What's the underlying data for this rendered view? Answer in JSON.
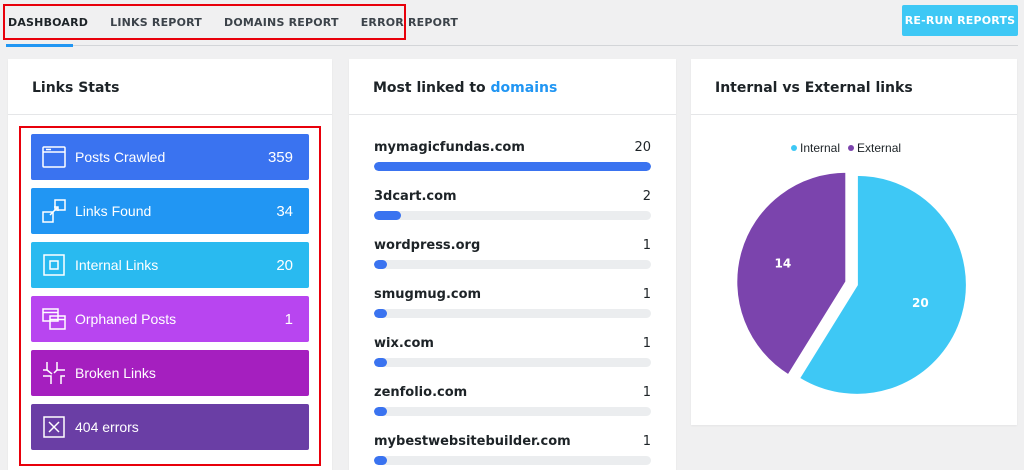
{
  "nav": {
    "tabs": [
      "DASHBOARD",
      "LINKS REPORT",
      "DOMAINS REPORT",
      "ERROR REPORT"
    ],
    "rerun_label": "RE-RUN REPORTS"
  },
  "links_stats": {
    "title": "Links Stats",
    "items": [
      {
        "label": "Posts Crawled",
        "value": "359",
        "color": "#3a73f0",
        "icon": "browser-window-icon"
      },
      {
        "label": "Links Found",
        "value": "34",
        "color": "#2196f3",
        "icon": "link-arrows-icon"
      },
      {
        "label": "Internal Links",
        "value": "20",
        "color": "#29baf0",
        "icon": "internal-square-icon"
      },
      {
        "label": "Orphaned Posts",
        "value": "1",
        "color": "#b845f0",
        "icon": "stacked-windows-icon"
      },
      {
        "label": "Broken Links",
        "value": "",
        "color": "#a51fbf",
        "icon": "broken-link-icon"
      },
      {
        "label": "404 errors",
        "value": "",
        "color": "#6a3ea5",
        "icon": "x-box-icon"
      }
    ]
  },
  "domains": {
    "title_prefix": "Most linked to",
    "title_accent": "domains",
    "max": 20,
    "items": [
      {
        "name": "mymagicfundas.com",
        "count": 20
      },
      {
        "name": "3dcart.com",
        "count": 2
      },
      {
        "name": "wordpress.org",
        "count": 1
      },
      {
        "name": "smugmug.com",
        "count": 1
      },
      {
        "name": "wix.com",
        "count": 1
      },
      {
        "name": "zenfolio.com",
        "count": 1
      },
      {
        "name": "mybestwebsitebuilder.com",
        "count": 1
      }
    ]
  },
  "pie_card": {
    "title": "Internal vs External links"
  },
  "chart_data": {
    "type": "pie",
    "labels": [
      "Internal",
      "External"
    ],
    "values": [
      20,
      14
    ],
    "colors": [
      "#3ec8f5",
      "#7b44ad"
    ],
    "legend": "top"
  }
}
